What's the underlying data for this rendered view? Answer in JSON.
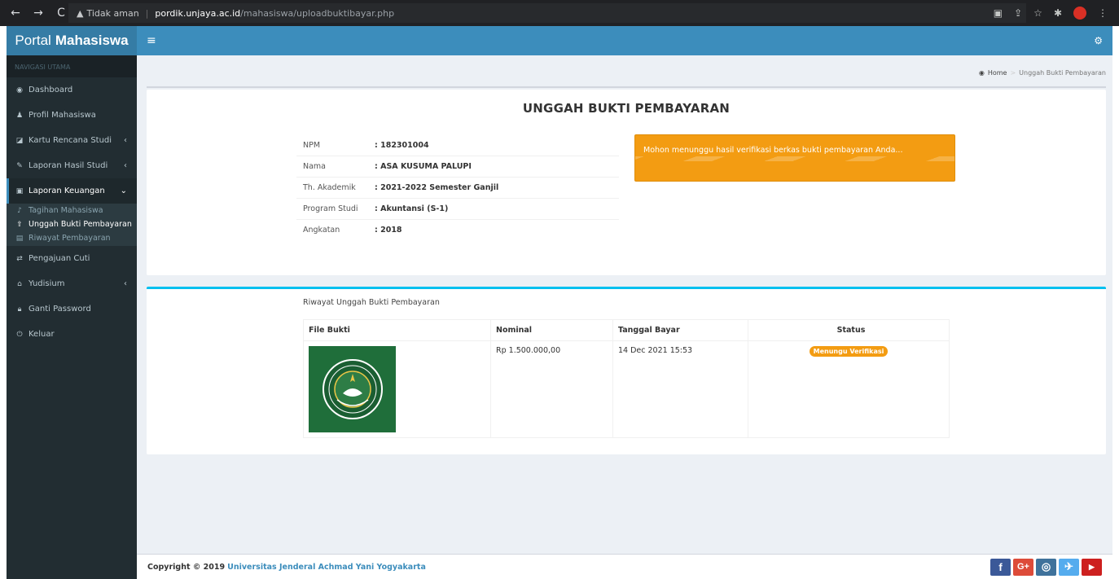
{
  "browser": {
    "security_label": "Tidak aman",
    "url_host": "pordik.unjaya.ac.id",
    "url_path": "/mahasiswa/uploadbuktibayar.php"
  },
  "app": {
    "logo_light": "Portal",
    "logo_bold": "Mahasiswa",
    "brand_color": "#3c8dbc",
    "sidebar_color": "#222d32"
  },
  "sidebar": {
    "header": "NAVIGASI UTAMA",
    "items": [
      {
        "label": "Dashboard",
        "icon": "dashboard-icon"
      },
      {
        "label": "Profil Mahasiswa",
        "icon": "user-icon"
      },
      {
        "label": "Kartu Rencana Studi",
        "icon": "edit-icon"
      },
      {
        "label": "Laporan Hasil Studi",
        "icon": "pencil-icon"
      },
      {
        "label": "Laporan Keuangan",
        "icon": "money-icon"
      },
      {
        "label": "Pengajuan Cuti",
        "icon": "exchange-icon"
      },
      {
        "label": "Yudisium",
        "icon": "graduation-cap-icon"
      },
      {
        "label": "Ganti Password",
        "icon": "lock-icon"
      },
      {
        "label": "Keluar",
        "icon": "power-icon"
      }
    ],
    "sub_items": [
      {
        "label": "Tagihan Mahasiswa",
        "icon": "bell-icon"
      },
      {
        "label": "Unggah Bukti Pembayaran",
        "icon": "upload-icon"
      },
      {
        "label": "Riwayat Pembayaran",
        "icon": "list-icon"
      }
    ]
  },
  "breadcrumb": {
    "home": "Home",
    "current": "Unggah Bukti Pembayaran"
  },
  "page": {
    "title": "UNGGAH BUKTI PEMBAYARAN",
    "info": [
      {
        "label": "NPM",
        "value": ": 182301004"
      },
      {
        "label": "Nama",
        "value": ": ASA KUSUMA PALUPI"
      },
      {
        "label": "Th. Akademik",
        "value": ": 2021-2022 Semester Ganjil"
      },
      {
        "label": "Program Studi",
        "value": ": Akuntansi (S-1)"
      },
      {
        "label": "Angkatan",
        "value": ": 2018"
      }
    ],
    "alert": "Mohon menunggu hasil verifikasi berkas bukti pembayaran Anda...",
    "alert_color": "#f39c12"
  },
  "history": {
    "title": "Riwayat Unggah Bukti Pembayaran",
    "headers": [
      "File Bukti",
      "Nominal",
      "Tanggal Bayar",
      "Status"
    ],
    "rows": [
      {
        "nominal": "Rp 1.500.000,00",
        "date": "14 Dec 2021 15:53",
        "status": "Menungu Verifikasi"
      }
    ]
  },
  "footer": {
    "prefix": "Copyright © 2019",
    "org": "Universitas Jenderal Achmad Yani Yogyakarta"
  }
}
